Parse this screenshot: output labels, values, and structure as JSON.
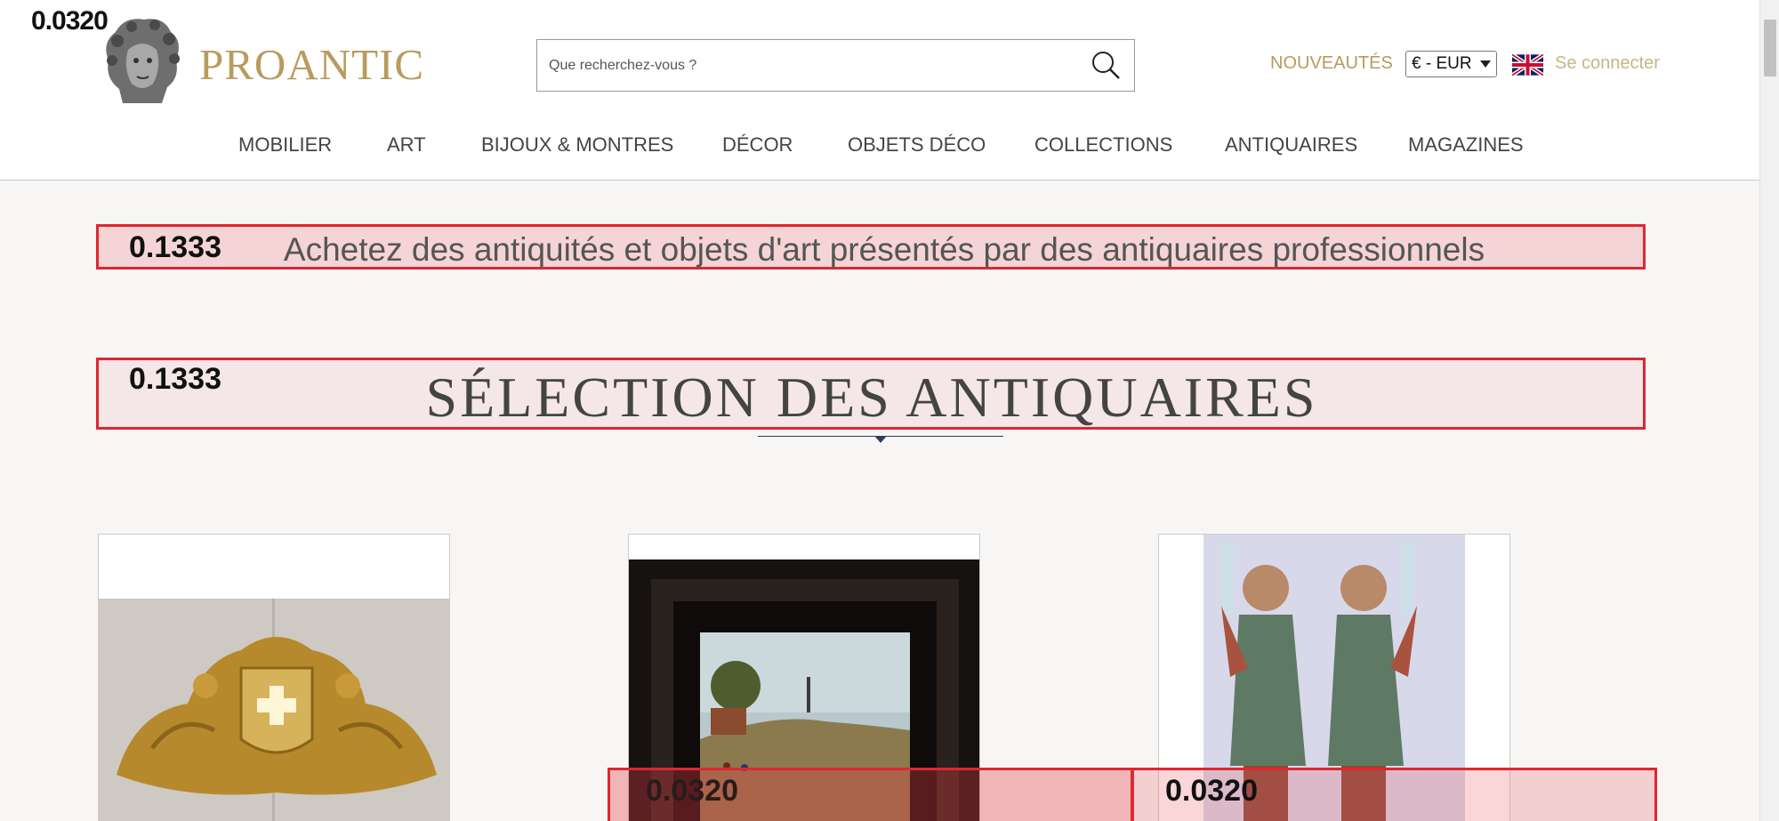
{
  "header": {
    "logo_text": "PROANTIC",
    "search": {
      "placeholder": "Que recherchez-vous ?"
    },
    "nouveautes_label": "NOUVEAUTÉS",
    "currency_value": "€ - EUR",
    "login_label": "Se connecter"
  },
  "nav": {
    "items": [
      "MOBILIER",
      "ART",
      "BIJOUX & MONTRES",
      "DÉCOR",
      "OBJETS DÉCO",
      "COLLECTIONS",
      "ANTIQUAIRES",
      "MAGAZINES"
    ]
  },
  "main": {
    "tagline": "Achetez des antiquités et objets d'art présentés par des antiquaires professionnels",
    "section_title": "SÉLECTION DES ANTIQUAIRES"
  },
  "overlays": {
    "corner_score": "0.0320",
    "tagline_score": "0.1333",
    "section_score": "0.1333",
    "bottom_score_1": "0.0320",
    "bottom_score_2": "0.0320"
  },
  "colors": {
    "brand_gold": "#b89b5e",
    "overlay_red": "#e0262f",
    "divider_navy": "#2c3e5a"
  },
  "icons": {
    "logo": "bust-logo-icon",
    "search": "search-icon",
    "flag": "uk-flag-icon"
  }
}
